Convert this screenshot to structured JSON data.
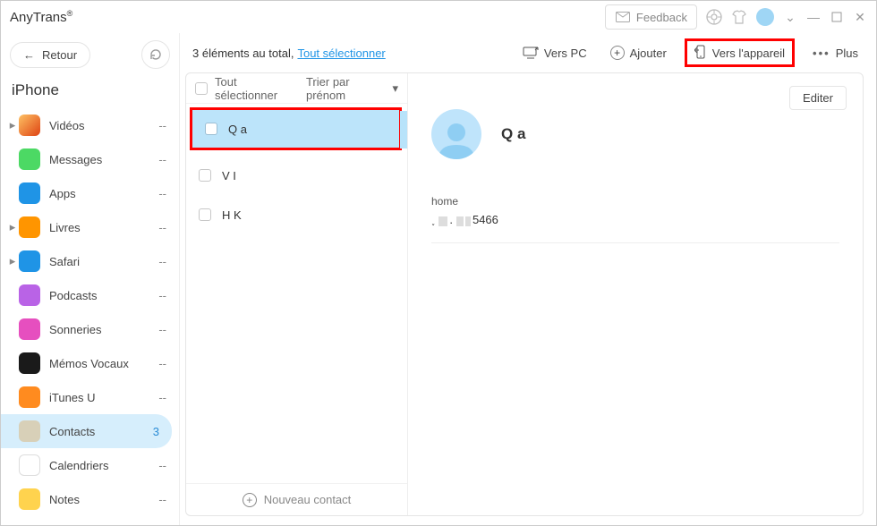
{
  "app": {
    "title": "AnyTrans",
    "trademark": "®"
  },
  "titlebar": {
    "feedback": "Feedback"
  },
  "sidebar": {
    "back": "Retour",
    "device": "iPhone",
    "items": [
      {
        "label": "Vidéos",
        "count": "--",
        "caret": true,
        "icon_bg": "linear-gradient(135deg,#fec163,#de4313)",
        "name": "sidebar-item-videos"
      },
      {
        "label": "Messages",
        "count": "--",
        "caret": false,
        "icon_bg": "#4cd964",
        "name": "sidebar-item-messages"
      },
      {
        "label": "Apps",
        "count": "--",
        "caret": false,
        "icon_bg": "#1f94e6",
        "name": "sidebar-item-apps"
      },
      {
        "label": "Livres",
        "count": "--",
        "caret": true,
        "icon_bg": "#ff9500",
        "name": "sidebar-item-books"
      },
      {
        "label": "Safari",
        "count": "--",
        "caret": true,
        "icon_bg": "#1f94e6",
        "name": "sidebar-item-safari"
      },
      {
        "label": "Podcasts",
        "count": "--",
        "caret": false,
        "icon_bg": "#b963e6",
        "name": "sidebar-item-podcasts"
      },
      {
        "label": "Sonneries",
        "count": "--",
        "caret": false,
        "icon_bg": "#e64fbf",
        "name": "sidebar-item-ringtones"
      },
      {
        "label": "Mémos Vocaux",
        "count": "--",
        "caret": false,
        "icon_bg": "#1a1a1a",
        "name": "sidebar-item-voicememos"
      },
      {
        "label": "iTunes U",
        "count": "--",
        "caret": false,
        "icon_bg": "#ff8b1f",
        "name": "sidebar-item-itunesu"
      },
      {
        "label": "Contacts",
        "count": "3",
        "caret": false,
        "icon_bg": "#d8d0b8",
        "name": "sidebar-item-contacts",
        "active": true
      },
      {
        "label": "Calendriers",
        "count": "--",
        "caret": false,
        "icon_bg": "#ffffff",
        "name": "sidebar-item-calendars"
      },
      {
        "label": "Notes",
        "count": "--",
        "caret": false,
        "icon_bg": "#ffd34e",
        "name": "sidebar-item-notes"
      }
    ]
  },
  "toolbar": {
    "summary_prefix": "3 éléments au total, ",
    "select_all_link": "Tout sélectionner",
    "to_pc": "Vers PC",
    "add": "Ajouter",
    "to_device": "Vers l'appareil",
    "more": "Plus"
  },
  "list": {
    "header_select_all": "Tout sélectionner",
    "header_sort": "Trier par prénom",
    "rows": [
      {
        "name": "Q a",
        "selected": true
      },
      {
        "name": "V I",
        "selected": false
      },
      {
        "name": "H K",
        "selected": false
      }
    ],
    "new_contact": "Nouveau contact"
  },
  "detail": {
    "edit": "Editer",
    "name": "Q a",
    "field_label": "home",
    "phone_suffix": "5466"
  }
}
